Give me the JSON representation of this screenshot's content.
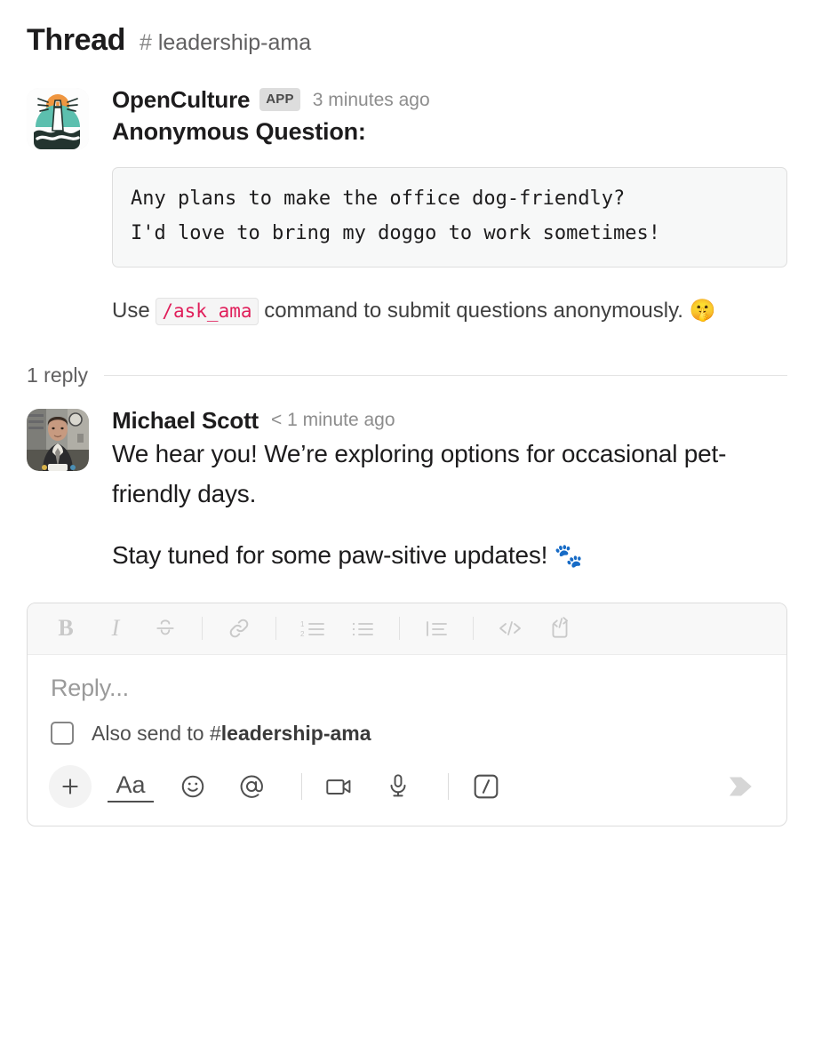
{
  "header": {
    "title": "Thread",
    "hash": "#",
    "channel": "leadership-ama"
  },
  "colors": {
    "text": "#1d1c1d",
    "muted": "#616061",
    "timestamp": "#8d8d8d",
    "inline_code": "#e01e5a",
    "badge_bg": "#dddddd",
    "border": "#dcdcdc",
    "toolbar_bg": "#f8f8f8",
    "avatar_teal": "#5cbfae",
    "avatar_orange": "#ef9640",
    "avatar_dark": "#23342f"
  },
  "root_message": {
    "avatar_name": "opencultu‌re-lighthouse-avatar",
    "author": "OpenCulture",
    "app_badge": "APP",
    "timestamp": "3 minutes ago",
    "heading": "Anonymous Question:",
    "quote": "Any plans to make the office dog-friendly?\nI'd love to bring my doggo to work sometimes!",
    "hint_prefix": "Use",
    "hint_command": "/ask_ama",
    "hint_suffix": "command to submit questions anonymously.",
    "hint_emoji": "🤫"
  },
  "thread": {
    "reply_count_label": "1 reply"
  },
  "reply": {
    "avatar_name": "michael-scott-photo-avatar",
    "author": "Michael Scott",
    "timestamp": "< 1 minute ago",
    "paragraph_1": "We hear you! We’re exploring options for occasional pet-friendly days.",
    "paragraph_2": "Stay tuned for some paw-sitive updates!",
    "paragraph_2_emoji": "🐾"
  },
  "composer": {
    "format_toolbar": [
      {
        "name": "bold",
        "glyph": "B"
      },
      {
        "name": "italic",
        "glyph": "I"
      },
      {
        "name": "strikethrough",
        "glyph": "S"
      },
      {
        "name": "link",
        "glyph": "link"
      },
      {
        "name": "ordered-list",
        "glyph": "1 2"
      },
      {
        "name": "bulleted-list",
        "glyph": "bullets"
      },
      {
        "name": "blockquote",
        "glyph": "quote"
      },
      {
        "name": "code",
        "glyph": "</>"
      },
      {
        "name": "code-block",
        "glyph": "</> block"
      }
    ],
    "input_placeholder": "Reply...",
    "also_send_label": "Also send to",
    "also_send_hash": "#",
    "also_send_channel": "leadership-ama",
    "also_send_checked": false,
    "actions": [
      {
        "name": "attachment",
        "label": "+"
      },
      {
        "name": "formatting",
        "label": "Aa"
      },
      {
        "name": "emoji",
        "label": "emoji"
      },
      {
        "name": "mention",
        "label": "@"
      },
      {
        "name": "video",
        "label": "video"
      },
      {
        "name": "audio",
        "label": "mic"
      },
      {
        "name": "slash-command",
        "label": "/"
      }
    ],
    "send_label": "Send"
  }
}
